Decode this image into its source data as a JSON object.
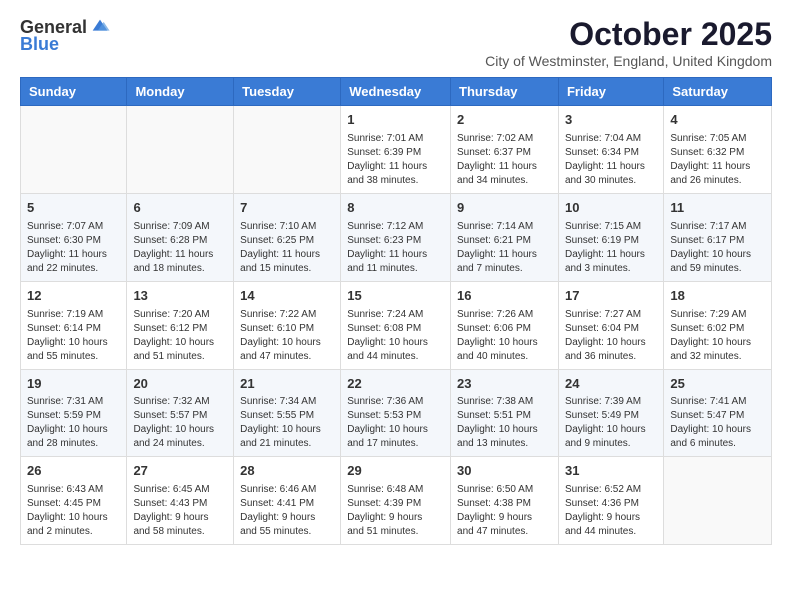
{
  "logo": {
    "text_general": "General",
    "text_blue": "Blue"
  },
  "header": {
    "month": "October 2025",
    "location": "City of Westminster, England, United Kingdom"
  },
  "days_of_week": [
    "Sunday",
    "Monday",
    "Tuesday",
    "Wednesday",
    "Thursday",
    "Friday",
    "Saturday"
  ],
  "weeks": [
    [
      {
        "day": "",
        "info": ""
      },
      {
        "day": "",
        "info": ""
      },
      {
        "day": "",
        "info": ""
      },
      {
        "day": "1",
        "info": "Sunrise: 7:01 AM\nSunset: 6:39 PM\nDaylight: 11 hours\nand 38 minutes."
      },
      {
        "day": "2",
        "info": "Sunrise: 7:02 AM\nSunset: 6:37 PM\nDaylight: 11 hours\nand 34 minutes."
      },
      {
        "day": "3",
        "info": "Sunrise: 7:04 AM\nSunset: 6:34 PM\nDaylight: 11 hours\nand 30 minutes."
      },
      {
        "day": "4",
        "info": "Sunrise: 7:05 AM\nSunset: 6:32 PM\nDaylight: 11 hours\nand 26 minutes."
      }
    ],
    [
      {
        "day": "5",
        "info": "Sunrise: 7:07 AM\nSunset: 6:30 PM\nDaylight: 11 hours\nand 22 minutes."
      },
      {
        "day": "6",
        "info": "Sunrise: 7:09 AM\nSunset: 6:28 PM\nDaylight: 11 hours\nand 18 minutes."
      },
      {
        "day": "7",
        "info": "Sunrise: 7:10 AM\nSunset: 6:25 PM\nDaylight: 11 hours\nand 15 minutes."
      },
      {
        "day": "8",
        "info": "Sunrise: 7:12 AM\nSunset: 6:23 PM\nDaylight: 11 hours\nand 11 minutes."
      },
      {
        "day": "9",
        "info": "Sunrise: 7:14 AM\nSunset: 6:21 PM\nDaylight: 11 hours\nand 7 minutes."
      },
      {
        "day": "10",
        "info": "Sunrise: 7:15 AM\nSunset: 6:19 PM\nDaylight: 11 hours\nand 3 minutes."
      },
      {
        "day": "11",
        "info": "Sunrise: 7:17 AM\nSunset: 6:17 PM\nDaylight: 10 hours\nand 59 minutes."
      }
    ],
    [
      {
        "day": "12",
        "info": "Sunrise: 7:19 AM\nSunset: 6:14 PM\nDaylight: 10 hours\nand 55 minutes."
      },
      {
        "day": "13",
        "info": "Sunrise: 7:20 AM\nSunset: 6:12 PM\nDaylight: 10 hours\nand 51 minutes."
      },
      {
        "day": "14",
        "info": "Sunrise: 7:22 AM\nSunset: 6:10 PM\nDaylight: 10 hours\nand 47 minutes."
      },
      {
        "day": "15",
        "info": "Sunrise: 7:24 AM\nSunset: 6:08 PM\nDaylight: 10 hours\nand 44 minutes."
      },
      {
        "day": "16",
        "info": "Sunrise: 7:26 AM\nSunset: 6:06 PM\nDaylight: 10 hours\nand 40 minutes."
      },
      {
        "day": "17",
        "info": "Sunrise: 7:27 AM\nSunset: 6:04 PM\nDaylight: 10 hours\nand 36 minutes."
      },
      {
        "day": "18",
        "info": "Sunrise: 7:29 AM\nSunset: 6:02 PM\nDaylight: 10 hours\nand 32 minutes."
      }
    ],
    [
      {
        "day": "19",
        "info": "Sunrise: 7:31 AM\nSunset: 5:59 PM\nDaylight: 10 hours\nand 28 minutes."
      },
      {
        "day": "20",
        "info": "Sunrise: 7:32 AM\nSunset: 5:57 PM\nDaylight: 10 hours\nand 24 minutes."
      },
      {
        "day": "21",
        "info": "Sunrise: 7:34 AM\nSunset: 5:55 PM\nDaylight: 10 hours\nand 21 minutes."
      },
      {
        "day": "22",
        "info": "Sunrise: 7:36 AM\nSunset: 5:53 PM\nDaylight: 10 hours\nand 17 minutes."
      },
      {
        "day": "23",
        "info": "Sunrise: 7:38 AM\nSunset: 5:51 PM\nDaylight: 10 hours\nand 13 minutes."
      },
      {
        "day": "24",
        "info": "Sunrise: 7:39 AM\nSunset: 5:49 PM\nDaylight: 10 hours\nand 9 minutes."
      },
      {
        "day": "25",
        "info": "Sunrise: 7:41 AM\nSunset: 5:47 PM\nDaylight: 10 hours\nand 6 minutes."
      }
    ],
    [
      {
        "day": "26",
        "info": "Sunrise: 6:43 AM\nSunset: 4:45 PM\nDaylight: 10 hours\nand 2 minutes."
      },
      {
        "day": "27",
        "info": "Sunrise: 6:45 AM\nSunset: 4:43 PM\nDaylight: 9 hours\nand 58 minutes."
      },
      {
        "day": "28",
        "info": "Sunrise: 6:46 AM\nSunset: 4:41 PM\nDaylight: 9 hours\nand 55 minutes."
      },
      {
        "day": "29",
        "info": "Sunrise: 6:48 AM\nSunset: 4:39 PM\nDaylight: 9 hours\nand 51 minutes."
      },
      {
        "day": "30",
        "info": "Sunrise: 6:50 AM\nSunset: 4:38 PM\nDaylight: 9 hours\nand 47 minutes."
      },
      {
        "day": "31",
        "info": "Sunrise: 6:52 AM\nSunset: 4:36 PM\nDaylight: 9 hours\nand 44 minutes."
      },
      {
        "day": "",
        "info": ""
      }
    ]
  ]
}
